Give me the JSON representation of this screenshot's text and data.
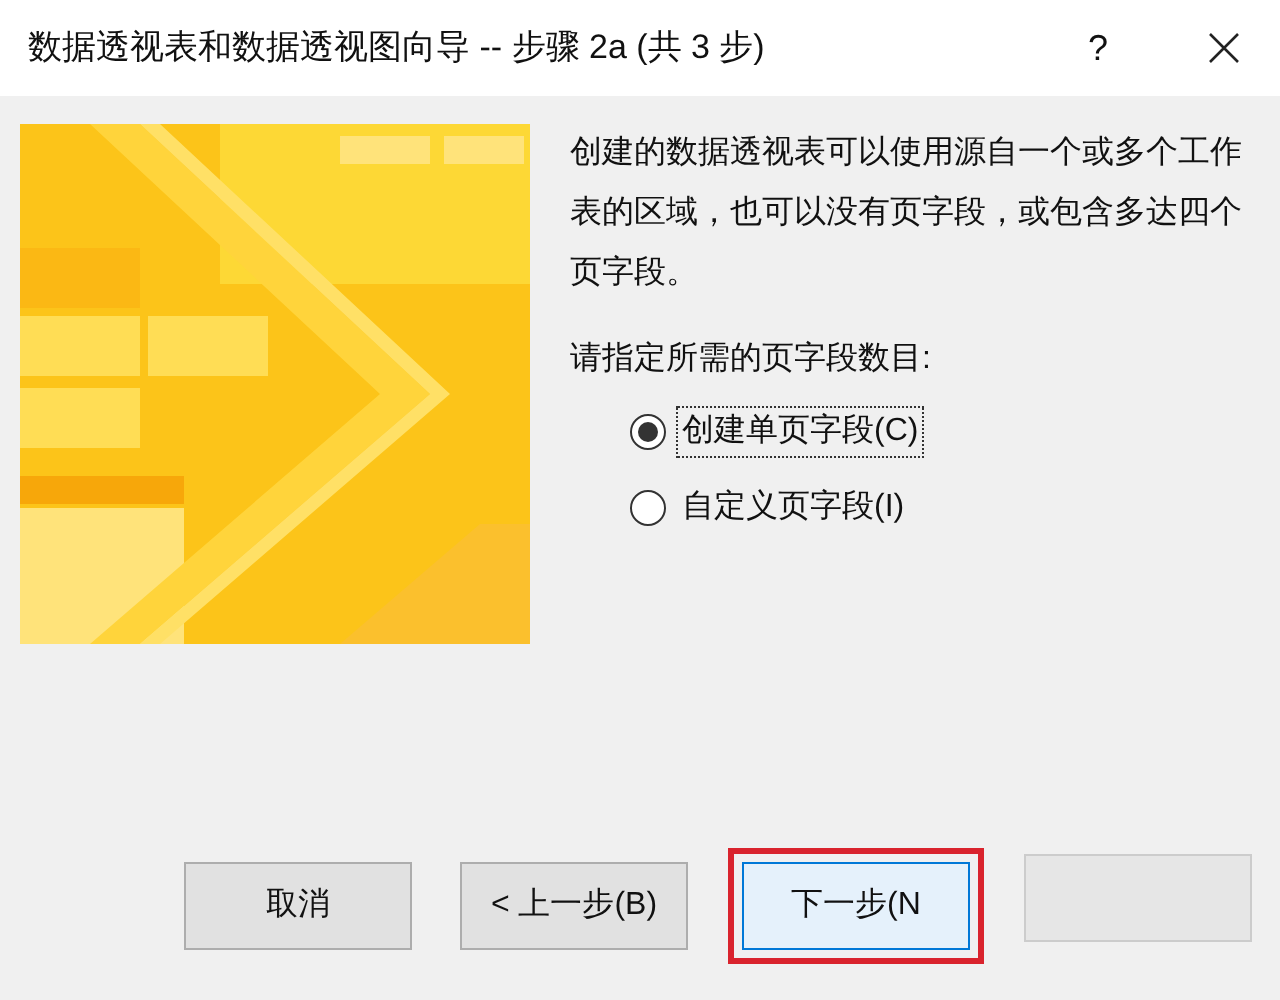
{
  "window": {
    "title": "数据透视表和数据透视图向导 -- 步骤 2a (共 3 步)",
    "help": "?"
  },
  "description": "创建的数据透视表可以使用源自一个或多个工作表的区域，也可以没有页字段，或包含多达四个页字段。",
  "prompt": "请指定所需的页字段数目:",
  "options": [
    {
      "label": "创建单页字段(C)",
      "selected": true
    },
    {
      "label": "自定义页字段(I)",
      "selected": false
    }
  ],
  "buttons": [
    {
      "label": "取消",
      "disabled": false,
      "highlighted": false
    },
    {
      "label": "< 上一步(B)",
      "disabled": false,
      "highlighted": false
    },
    {
      "label": "下一步(N",
      "disabled": false,
      "highlighted": true
    },
    {
      "disabled": true,
      "highlighted": false
    }
  ]
}
